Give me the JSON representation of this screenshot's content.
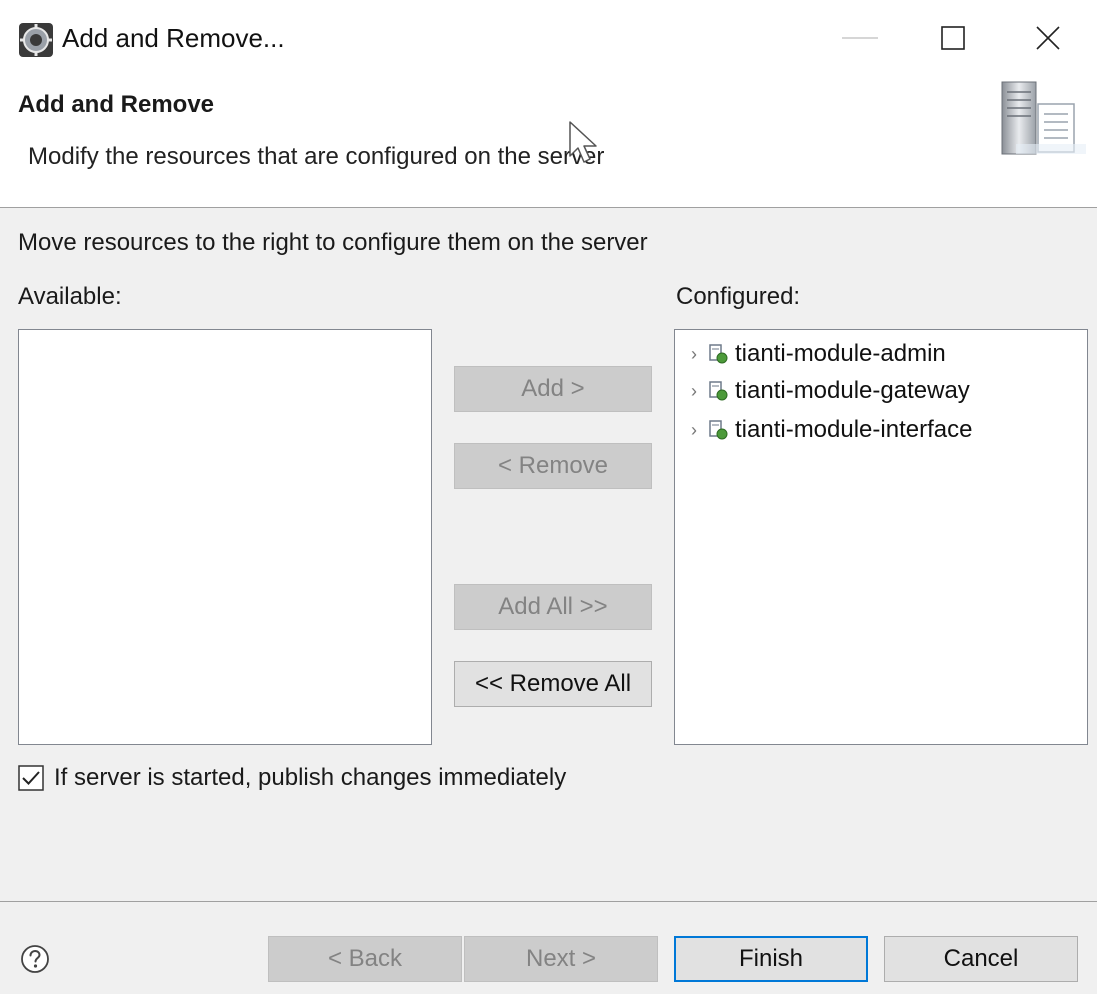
{
  "window": {
    "title": "Add and Remove...",
    "icon": "eclipse-gear-icon",
    "controls": [
      "minimize-icon",
      "maximize-icon",
      "close-icon"
    ]
  },
  "banner": {
    "title": "Add and Remove",
    "description": "Modify the resources that are configured on the server",
    "icon": "server-icon"
  },
  "body": {
    "instructions": "Move resources to the right to configure them on the server",
    "available_label": "Available:",
    "configured_label": "Configured:",
    "available_items": [],
    "configured_items": [
      {
        "label": "tianti-module-admin",
        "icon": "web-module-icon",
        "expandable": true
      },
      {
        "label": "tianti-module-gateway",
        "icon": "web-module-icon",
        "expandable": true
      },
      {
        "label": "tianti-module-interface",
        "icon": "web-module-icon",
        "expandable": true
      }
    ],
    "buttons": {
      "add": {
        "label": "Add >",
        "enabled": false
      },
      "remove": {
        "label": "< Remove",
        "enabled": false
      },
      "add_all": {
        "label": "Add All >>",
        "enabled": false
      },
      "remove_all": {
        "label": "<< Remove All",
        "enabled": true
      }
    },
    "publish_checkbox": {
      "label": "If server is started, publish changes immediately",
      "checked": true
    }
  },
  "footer": {
    "help_icon": "help-icon",
    "back": {
      "label": "< Back",
      "enabled": false
    },
    "next": {
      "label": "Next >",
      "enabled": false
    },
    "finish": {
      "label": "Finish",
      "enabled": true,
      "default": true
    },
    "cancel": {
      "label": "Cancel",
      "enabled": true
    }
  },
  "colors": {
    "dialog_bg": "#f0f0f0",
    "disabled_button_bg": "#cccccc",
    "default_button_border": "#0078d7"
  }
}
